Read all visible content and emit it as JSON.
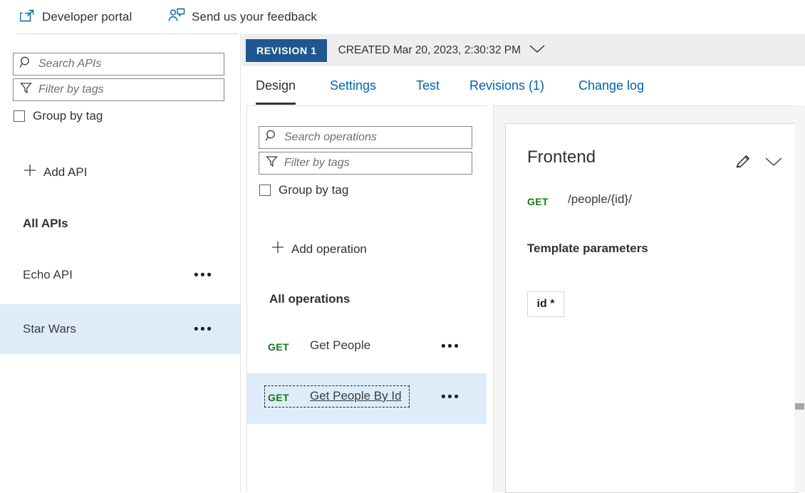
{
  "topbar": {
    "commands": [
      {
        "label": "Developer portal",
        "icon": "external-link-icon"
      },
      {
        "label": "Send us your feedback",
        "icon": "feedback-person-icon"
      }
    ]
  },
  "api_rail": {
    "search": {
      "placeholder": "Search APIs",
      "value": "",
      "icon": "search-icon"
    },
    "filter": {
      "placeholder": "Filter by tags",
      "value": "",
      "icon": "funnel-icon"
    },
    "group_by_tag": {
      "label": "Group by tag",
      "checked": false
    },
    "add_api": {
      "label": "Add API",
      "icon": "plus-icon"
    },
    "all_apis_header": "All APIs",
    "items": [
      {
        "name": "Echo API",
        "selected": false,
        "more": "•••"
      },
      {
        "name": "Star Wars",
        "selected": true,
        "more": "•••"
      }
    ]
  },
  "revision_bar": {
    "badge": "REVISION 1",
    "created": "CREATED Mar 20, 2023, 2:30:32 PM",
    "chevron_icon": "chevron-down-icon"
  },
  "tabs": [
    {
      "label": "Design",
      "active": true
    },
    {
      "label": "Settings",
      "active": false
    },
    {
      "label": "Test",
      "active": false
    },
    {
      "label": "Revisions (1)",
      "active": false
    },
    {
      "label": "Change log",
      "active": false
    }
  ],
  "operations_pane": {
    "search": {
      "placeholder": "Search operations",
      "value": "",
      "icon": "search-icon"
    },
    "filter": {
      "placeholder": "Filter by tags",
      "value": "",
      "icon": "funnel-icon"
    },
    "group_by_tag": {
      "label": "Group by tag",
      "checked": false
    },
    "add_operation": {
      "label": "Add operation",
      "icon": "plus-icon"
    },
    "all_operations_header": "All operations",
    "items": [
      {
        "method": "GET",
        "name": "Get People",
        "selected": false,
        "more": "•••"
      },
      {
        "method": "GET",
        "name": "Get People By Id",
        "selected": true,
        "more": "•••"
      }
    ]
  },
  "frontend_card": {
    "title": "Frontend",
    "edit_icon": "pencil-icon",
    "collapse_icon": "chevron-down-icon",
    "method": "GET",
    "url": "/people/{id}/",
    "template_parameters_header": "Template parameters",
    "template_parameters": [
      {
        "name": "id *"
      }
    ]
  },
  "colors": {
    "accent_blue": "#0063b1",
    "revision_badge": "#1e5791",
    "method_green": "#107c10",
    "selection_blue": "#deecf9",
    "panel_gray": "#f5f5f5",
    "revbar_gray": "#eeeeee"
  }
}
